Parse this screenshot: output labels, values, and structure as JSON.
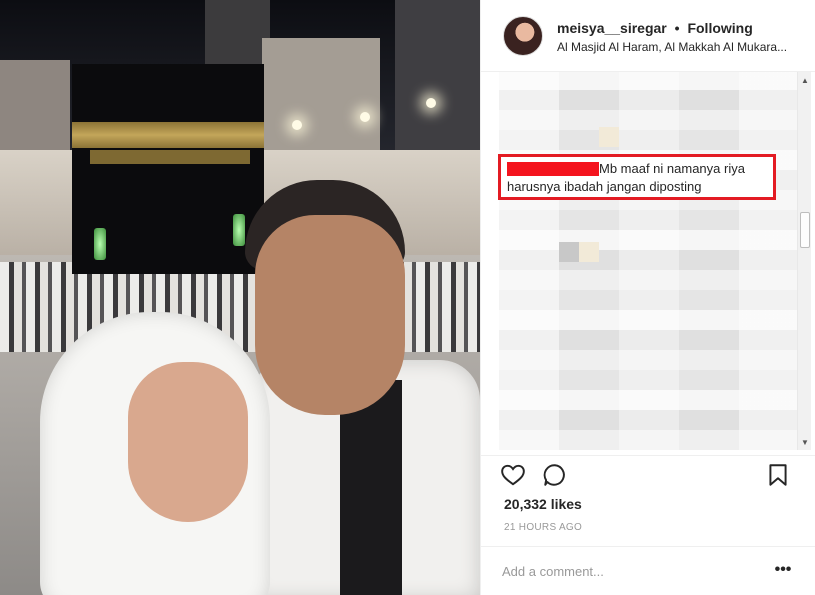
{
  "post": {
    "photo_alt": "selfie-at-masjid-al-haram",
    "username": "meisya__siregar",
    "separator": "•",
    "follow_status": "Following",
    "location": "Al Masjid Al Haram, Al Makkah Al Mukara..."
  },
  "highlighted_comment": {
    "line1": "Mb maaf ni namanya riya",
    "line2": "harusnya ibadah jangan diposting",
    "box_color": "#e31b23",
    "redaction_color": "#f4141e"
  },
  "icons": {
    "like": "heart-icon",
    "comment": "speech-bubble-icon",
    "save": "bookmark-icon",
    "more": "ellipsis-icon",
    "scroll_up": "scroll-up-arrow-icon",
    "scroll_down": "scroll-down-arrow-icon"
  },
  "scroll_glyphs": {
    "up": "▲",
    "down": "▼"
  },
  "stats": {
    "likes": "20,332 likes",
    "time": "21 HOURS AGO"
  },
  "add_comment": {
    "placeholder": "Add a comment..."
  },
  "more_glyph": "•••"
}
